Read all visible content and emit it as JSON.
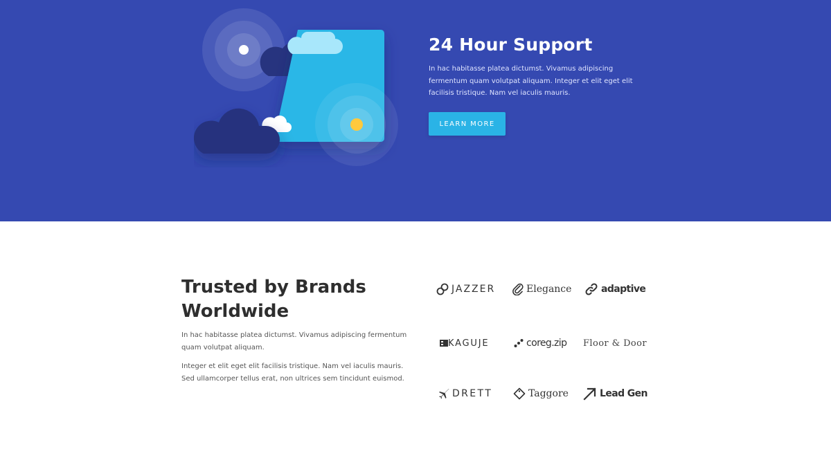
{
  "hero": {
    "background": "#3549b1",
    "title": "24 Hour Support",
    "description": "In hac habitasse platea dictumst. Vivamus adipiscing fermentum quam volutpat aliquam. Integer et elit eget elit facilisis tristique. Nam vel iaculis mauris.",
    "button_label": "LEARN MORE",
    "button_color": "#2ab3e6"
  },
  "brands": {
    "title": "Trusted by Brands Worldwide",
    "paragraph_1": "In hac habitasse platea dictumst. Vivamus adipiscing fermentum quam volutpat aliquam.",
    "paragraph_2": "Integer et elit eget elit facilisis tristique. Nam vel iaculis mauris. Sed ullamcorper tellus erat, non ultrices sem tincidunt euismod.",
    "logos": [
      {
        "name": "JAZZER",
        "icon": "link-icon"
      },
      {
        "name": "Elegance",
        "icon": "paperclip-icon"
      },
      {
        "name": "adaptive",
        "icon": "chain-link-icon"
      },
      {
        "name": "KAGUJE",
        "icon": "film-icon"
      },
      {
        "name": "coreg.zip",
        "icon": "dots-icon"
      },
      {
        "name": "Floor & Door",
        "icon": ""
      },
      {
        "name": "DRETT",
        "icon": "airplane-icon"
      },
      {
        "name": "Taggore",
        "icon": "tag-icon"
      },
      {
        "name": "Lead Gen",
        "icon": "arrow-up-right-icon"
      }
    ]
  }
}
